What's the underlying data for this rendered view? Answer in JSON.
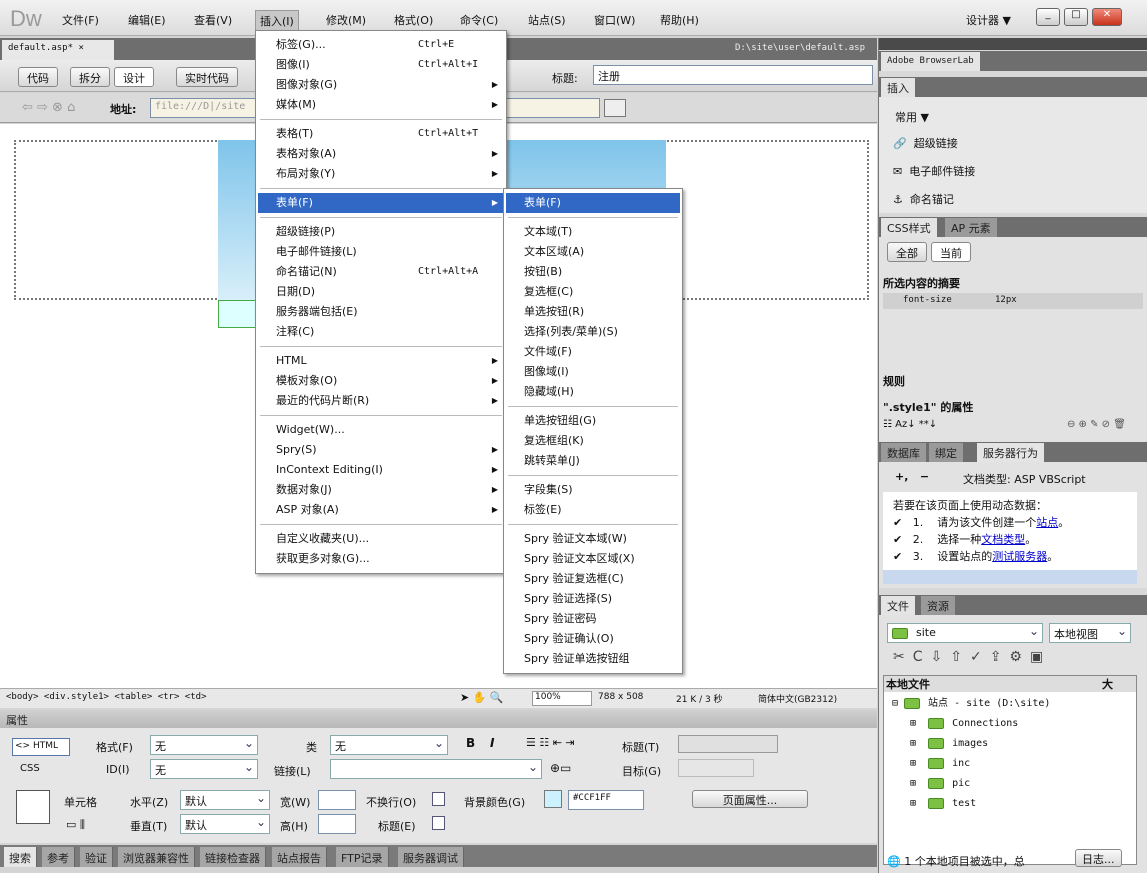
{
  "app": {
    "logo": "Dw",
    "menus": [
      "文件(F)",
      "编辑(E)",
      "查看(V)",
      "插入(I)",
      "修改(M)",
      "格式(O)",
      "命令(C)",
      "站点(S)",
      "窗口(W)",
      "帮助(H)"
    ],
    "workspace": "设计器 ▼"
  },
  "document": {
    "tab": "default.asp* ×",
    "path": "D:\\site\\user\\default.asp"
  },
  "toolbar": {
    "code": "代码",
    "split": "拆分",
    "design": "设计",
    "live": "实时代码",
    "title_label": "标题:",
    "title_value": "注册"
  },
  "address": {
    "label": "地址:",
    "value": "file:///D|/site"
  },
  "status": {
    "tags": "<body> <div.style1> <table> <tr> <td>",
    "zoom": "100%",
    "size": "788 x 508",
    "download": "21 K / 3 秒",
    "encoding": "简体中文(GB2312)"
  },
  "insert_menu": [
    {
      "label": "标签(G)...",
      "sc": "Ctrl+E"
    },
    {
      "label": "图像(I)",
      "sc": "Ctrl+Alt+I"
    },
    {
      "label": "图像对象(G)",
      "sub": true
    },
    {
      "label": "媒体(M)",
      "sub": true
    },
    {
      "sep": true
    },
    {
      "label": "表格(T)",
      "sc": "Ctrl+Alt+T"
    },
    {
      "label": "表格对象(A)",
      "sub": true
    },
    {
      "label": "布局对象(Y)",
      "sub": true
    },
    {
      "sep": true
    },
    {
      "label": "表单(F)",
      "sub": true,
      "hl": true
    },
    {
      "sep": true
    },
    {
      "label": "超级链接(P)"
    },
    {
      "label": "电子邮件链接(L)"
    },
    {
      "label": "命名锚记(N)",
      "sc": "Ctrl+Alt+A"
    },
    {
      "label": "日期(D)"
    },
    {
      "label": "服务器端包括(E)"
    },
    {
      "label": "注释(C)"
    },
    {
      "sep": true
    },
    {
      "label": "HTML",
      "sub": true
    },
    {
      "label": "模板对象(O)",
      "sub": true
    },
    {
      "label": "最近的代码片断(R)",
      "sub": true
    },
    {
      "sep": true
    },
    {
      "label": "Widget(W)..."
    },
    {
      "label": "Spry(S)",
      "sub": true
    },
    {
      "label": "InContext Editing(I)",
      "sub": true
    },
    {
      "label": "数据对象(J)",
      "sub": true
    },
    {
      "label": "ASP 对象(A)",
      "sub": true
    },
    {
      "sep": true
    },
    {
      "label": "自定义收藏夹(U)..."
    },
    {
      "label": "获取更多对象(G)..."
    }
  ],
  "form_submenu": [
    {
      "label": "表单(F)",
      "hl": true
    },
    {
      "sep": true
    },
    {
      "label": "文本域(T)"
    },
    {
      "label": "文本区域(A)"
    },
    {
      "label": "按钮(B)"
    },
    {
      "label": "复选框(C)"
    },
    {
      "label": "单选按钮(R)"
    },
    {
      "label": "选择(列表/菜单)(S)"
    },
    {
      "label": "文件域(F)"
    },
    {
      "label": "图像域(I)"
    },
    {
      "label": "隐藏域(H)"
    },
    {
      "sep": true
    },
    {
      "label": "单选按钮组(G)"
    },
    {
      "label": "复选框组(K)"
    },
    {
      "label": "跳转菜单(J)"
    },
    {
      "sep": true
    },
    {
      "label": "字段集(S)"
    },
    {
      "label": "标签(E)"
    },
    {
      "sep": true
    },
    {
      "label": "Spry 验证文本域(W)"
    },
    {
      "label": "Spry 验证文本区域(X)"
    },
    {
      "label": "Spry 验证复选框(C)"
    },
    {
      "label": "Spry 验证选择(S)"
    },
    {
      "label": "Spry 验证密码"
    },
    {
      "label": "Spry 验证确认(O)"
    },
    {
      "label": "Spry 验证单选按钮组"
    }
  ],
  "properties": {
    "title": "属性",
    "html": "<> HTML",
    "css": "CSS",
    "format_label": "格式(F)",
    "format_value": "无",
    "class_label": "类",
    "class_value": "无",
    "id_label": "ID(I)",
    "id_value": "无",
    "link_label": "链接(L)",
    "title_label": "标题(T)",
    "target_label": "目标(G)",
    "cell": "单元格",
    "horz_label": "水平(Z)",
    "horz_value": "默认",
    "vert_label": "垂直(T)",
    "vert_value": "默认",
    "width_label": "宽(W)",
    "height_label": "高(H)",
    "nowrap_label": "不换行(O)",
    "header_label": "标题(E)",
    "bg_label": "背景颜色(G)",
    "bg_value": "#CCF1FF",
    "page_props": "页面属性..."
  },
  "bottom_tabs": [
    "搜索",
    "参考",
    "验证",
    "浏览器兼容性",
    "链接检查器",
    "站点报告",
    "FTP记录",
    "服务器调试"
  ],
  "right": {
    "browserlab": "Adobe BrowserLab",
    "insert_tab": "插入",
    "insert_category": "常用 ▼",
    "insert_items": [
      "超级链接",
      "电子邮件链接",
      "命名锚记"
    ],
    "css_tabs": [
      "CSS样式",
      "AP 元素"
    ],
    "css_modes": [
      "全部",
      "当前"
    ],
    "summary": "所选内容的摘要",
    "prop_name": "font-size",
    "prop_value": "12px",
    "rules": "规则",
    "props_for": "\".style1\" 的属性",
    "db_tabs": [
      "数据库",
      "绑定",
      "服务器行为"
    ],
    "doc_type": "文档类型: ASP VBScript",
    "dyn_intro": "若要在该页面上使用动态数据：",
    "dyn_steps": [
      {
        "n": "1.",
        "pre": "请为该文件创建一个",
        "link": "站点",
        "post": "。"
      },
      {
        "n": "2.",
        "pre": "选择一种",
        "link": "文档类型",
        "post": "。"
      },
      {
        "n": "3.",
        "pre": "设置站点的",
        "link": "测试服务器",
        "post": "。"
      }
    ],
    "files_tabs": [
      "文件",
      "资源"
    ],
    "site": "site",
    "view": "本地视图",
    "col_local": "本地文件",
    "col_size": "大",
    "tree_root": "站点 - site (D:\\site)",
    "folders": [
      "Connections",
      "images",
      "inc",
      "pic",
      "test"
    ],
    "footer": "1 个本地项目被选中，总",
    "log": "日志..."
  },
  "colors": {
    "highlight": "#3168c6",
    "link": "#0000cc",
    "folder": "#7cc144"
  }
}
